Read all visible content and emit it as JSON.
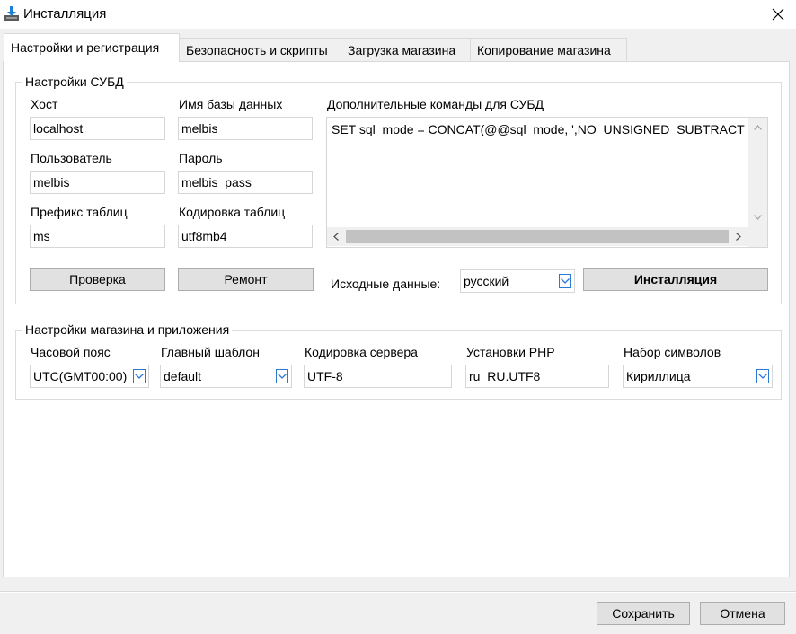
{
  "window": {
    "title": "Инсталляция"
  },
  "tabs": [
    {
      "label": "Настройки и регистрация"
    },
    {
      "label": "Безопасность и скрипты"
    },
    {
      "label": "Загрузка магазина"
    },
    {
      "label": "Копирование магазина"
    }
  ],
  "db_settings": {
    "title": "Настройки СУБД",
    "host_label": "Хост",
    "host_value": "localhost",
    "dbname_label": "Имя базы данных",
    "dbname_value": "melbis",
    "user_label": "Пользователь",
    "user_value": "melbis",
    "password_label": "Пароль",
    "password_value": "melbis_pass",
    "prefix_label": "Префикс таблиц",
    "prefix_value": "ms",
    "encoding_label": "Кодировка таблиц",
    "encoding_value": "utf8mb4",
    "extra_commands_label": "Дополнительные команды для СУБД",
    "extra_commands_value": "SET sql_mode = CONCAT(@@sql_mode, ',NO_UNSIGNED_SUBTRACTION')",
    "check_button": "Проверка",
    "repair_button": "Ремонт",
    "source_data_label": "Исходные данные:",
    "source_data_value": "русский",
    "install_button": "Инсталляция"
  },
  "shop_settings": {
    "title": "Настройки магазина и приложения",
    "timezone_label": "Часовой пояс",
    "timezone_value": "UTC(GMT00:00)",
    "template_label": "Главный шаблон",
    "template_value": "default",
    "server_encoding_label": "Кодировка сервера",
    "server_encoding_value": "UTF-8",
    "php_label": "Установки PHP",
    "php_value": "ru_RU.UTF8",
    "charset_label": "Набор символов",
    "charset_value": "Кириллица"
  },
  "footer": {
    "save_button": "Сохранить",
    "cancel_button": "Отмена"
  },
  "colors": {
    "accent": "#2b79d7",
    "app_icon": "#1e7fd6"
  }
}
